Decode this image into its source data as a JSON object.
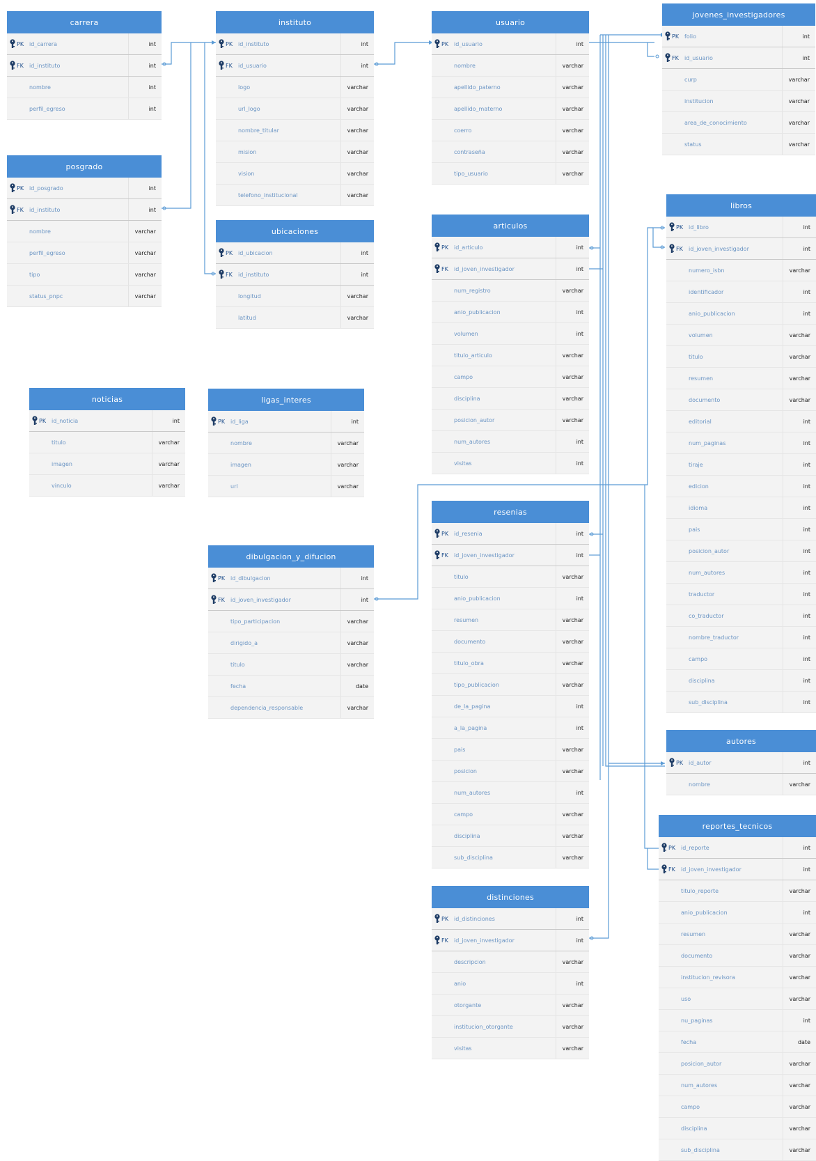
{
  "colors": {
    "header": "#4a8ed6",
    "body": "#f3f3f3",
    "connector": "#5b9bd5",
    "field_name": "#6b95c4",
    "key_icon": "#1f3d66"
  },
  "icons": {
    "key": "key-icon"
  },
  "tables": [
    {
      "id": "carrera",
      "title": "carrera",
      "rows": [
        {
          "key": "PK",
          "name": "id_carrera",
          "type": "int"
        },
        {
          "key": "FK",
          "name": "id_instituto",
          "type": "int"
        },
        {
          "key": "",
          "name": "nombre",
          "type": "int"
        },
        {
          "key": "",
          "name": "perfil_egreso",
          "type": "int"
        }
      ]
    },
    {
      "id": "posgrado",
      "title": "posgrado",
      "rows": [
        {
          "key": "PK",
          "name": "id_posgrado",
          "type": "int"
        },
        {
          "key": "FK",
          "name": "id_instituto",
          "type": "int"
        },
        {
          "key": "",
          "name": "nombre",
          "type": "varchar"
        },
        {
          "key": "",
          "name": "perfil_egreso",
          "type": "varchar"
        },
        {
          "key": "",
          "name": "tipo",
          "type": "varchar"
        },
        {
          "key": "",
          "name": "status_pnpc",
          "type": "varchar"
        }
      ]
    },
    {
      "id": "noticias",
      "title": "noticias",
      "rows": [
        {
          "key": "PK",
          "name": "id_noticia",
          "type": "int"
        },
        {
          "key": "",
          "name": "titulo",
          "type": "varchar"
        },
        {
          "key": "",
          "name": "imagen",
          "type": "varchar"
        },
        {
          "key": "",
          "name": "vinculo",
          "type": "varchar"
        }
      ]
    },
    {
      "id": "instituto",
      "title": "instituto",
      "rows": [
        {
          "key": "PK",
          "name": "id_instituto",
          "type": "int"
        },
        {
          "key": "FK",
          "name": "id_usuario",
          "type": "int"
        },
        {
          "key": "",
          "name": "logo",
          "type": "varchar"
        },
        {
          "key": "",
          "name": "url_logo",
          "type": "varchar"
        },
        {
          "key": "",
          "name": "nombre_titular",
          "type": "varchar"
        },
        {
          "key": "",
          "name": "mision",
          "type": "varchar"
        },
        {
          "key": "",
          "name": "vision",
          "type": "varchar"
        },
        {
          "key": "",
          "name": "telefono_institucional",
          "type": "varchar"
        }
      ]
    },
    {
      "id": "ubicaciones",
      "title": "ubicaciones",
      "rows": [
        {
          "key": "PK",
          "name": "id_ubicacion",
          "type": "int"
        },
        {
          "key": "FK",
          "name": "id_instituto",
          "type": "int"
        },
        {
          "key": "",
          "name": "longitud",
          "type": "varchar"
        },
        {
          "key": "",
          "name": "latitud",
          "type": "varchar"
        }
      ]
    },
    {
      "id": "ligas_interes",
      "title": "ligas_interes",
      "rows": [
        {
          "key": "PK",
          "name": "id_liga",
          "type": "int"
        },
        {
          "key": "",
          "name": "nombre",
          "type": "varchar"
        },
        {
          "key": "",
          "name": "imagen",
          "type": "varchar"
        },
        {
          "key": "",
          "name": "url",
          "type": "varchar"
        }
      ]
    },
    {
      "id": "dibulgacion",
      "title": "dibulgacion_y_difucion",
      "rows": [
        {
          "key": "PK",
          "name": "id_dibulgacion",
          "type": "int"
        },
        {
          "key": "FK",
          "name": "id_joven_investigador",
          "type": "int"
        },
        {
          "key": "",
          "name": "tipo_participacion",
          "type": "varchar"
        },
        {
          "key": "",
          "name": "dirigido_a",
          "type": "varchar"
        },
        {
          "key": "",
          "name": "titulo",
          "type": "varchar"
        },
        {
          "key": "",
          "name": "fecha",
          "type": "date"
        },
        {
          "key": "",
          "name": "dependencia_responsable",
          "type": "varchar"
        }
      ]
    },
    {
      "id": "usuario",
      "title": "usuario",
      "rows": [
        {
          "key": "PK",
          "name": "id_usuario",
          "type": "int"
        },
        {
          "key": "",
          "name": "nombre",
          "type": "varchar"
        },
        {
          "key": "",
          "name": "apellido_paterno",
          "type": "varchar"
        },
        {
          "key": "",
          "name": "apellido_materno",
          "type": "varchar"
        },
        {
          "key": "",
          "name": "coerro",
          "type": "varchar"
        },
        {
          "key": "",
          "name": "contraseña",
          "type": "varchar"
        },
        {
          "key": "",
          "name": "tipo_usuario",
          "type": "varchar"
        }
      ]
    },
    {
      "id": "articulos",
      "title": "articulos",
      "rows": [
        {
          "key": "PK",
          "name": "id_articulo",
          "type": "int"
        },
        {
          "key": "FK",
          "name": "id_joven_investigador",
          "type": "int"
        },
        {
          "key": "",
          "name": "num_registro",
          "type": "varchar"
        },
        {
          "key": "",
          "name": "anio_publicacion",
          "type": "int"
        },
        {
          "key": "",
          "name": "volumen",
          "type": "int"
        },
        {
          "key": "",
          "name": "titulo_articulo",
          "type": "varchar"
        },
        {
          "key": "",
          "name": "campo",
          "type": "varchar"
        },
        {
          "key": "",
          "name": "disciplina",
          "type": "varchar"
        },
        {
          "key": "",
          "name": "posicion_autor",
          "type": "varchar"
        },
        {
          "key": "",
          "name": "num_autores",
          "type": "int"
        },
        {
          "key": "",
          "name": "visitas",
          "type": "int"
        }
      ]
    },
    {
      "id": "resenias",
      "title": "resenias",
      "rows": [
        {
          "key": "PK",
          "name": "id_resenia",
          "type": "int"
        },
        {
          "key": "FK",
          "name": "id_joven_investigador",
          "type": "int"
        },
        {
          "key": "",
          "name": "titulo",
          "type": "varchar"
        },
        {
          "key": "",
          "name": "anio_publicacion",
          "type": "int"
        },
        {
          "key": "",
          "name": "resumen",
          "type": "varchar"
        },
        {
          "key": "",
          "name": "documento",
          "type": "varchar"
        },
        {
          "key": "",
          "name": "titulo_obra",
          "type": "varchar"
        },
        {
          "key": "",
          "name": "tipo_publicacion",
          "type": "varchar"
        },
        {
          "key": "",
          "name": "de_la_pagina",
          "type": "int"
        },
        {
          "key": "",
          "name": "a_la_pagina",
          "type": "int"
        },
        {
          "key": "",
          "name": "pais",
          "type": "varchar"
        },
        {
          "key": "",
          "name": "posicion",
          "type": "varchar"
        },
        {
          "key": "",
          "name": "num_autores",
          "type": "int"
        },
        {
          "key": "",
          "name": "campo",
          "type": "varchar"
        },
        {
          "key": "",
          "name": "disciplina",
          "type": "varchar"
        },
        {
          "key": "",
          "name": "sub_disciplina",
          "type": "varchar"
        }
      ]
    },
    {
      "id": "distinciones",
      "title": "distinciones",
      "rows": [
        {
          "key": "PK",
          "name": "id_distinciones",
          "type": "int"
        },
        {
          "key": "FK",
          "name": "id_joven_investigador",
          "type": "int"
        },
        {
          "key": "",
          "name": "descripcion",
          "type": "varchar"
        },
        {
          "key": "",
          "name": "anio",
          "type": "int"
        },
        {
          "key": "",
          "name": "otorgante",
          "type": "varchar"
        },
        {
          "key": "",
          "name": "institucion_otorgante",
          "type": "varchar"
        },
        {
          "key": "",
          "name": "visitas",
          "type": "varchar"
        }
      ]
    },
    {
      "id": "jovenes",
      "title": "jovenes_investigadores",
      "rows": [
        {
          "key": "PK",
          "name": "folio",
          "type": "int"
        },
        {
          "key": "FK",
          "name": "id_usuario",
          "type": "int"
        },
        {
          "key": "",
          "name": "curp",
          "type": "varchar"
        },
        {
          "key": "",
          "name": "institucion",
          "type": "varchar"
        },
        {
          "key": "",
          "name": "area_de_conocimiento",
          "type": "varchar"
        },
        {
          "key": "",
          "name": "status",
          "type": "varchar"
        }
      ]
    },
    {
      "id": "libros",
      "title": "libros",
      "rows": [
        {
          "key": "PK",
          "name": "id_libro",
          "type": "int"
        },
        {
          "key": "FK",
          "name": "id_joven_investigador",
          "type": "int"
        },
        {
          "key": "",
          "name": "numero_isbn",
          "type": "varchar"
        },
        {
          "key": "",
          "name": "identificador",
          "type": "int"
        },
        {
          "key": "",
          "name": "anio_publicacion",
          "type": "int"
        },
        {
          "key": "",
          "name": "volumen",
          "type": "varchar"
        },
        {
          "key": "",
          "name": "titulo",
          "type": "varchar"
        },
        {
          "key": "",
          "name": "resumen",
          "type": "varchar"
        },
        {
          "key": "",
          "name": "documento",
          "type": "varchar"
        },
        {
          "key": "",
          "name": "editorial",
          "type": "int"
        },
        {
          "key": "",
          "name": "num_paginas",
          "type": "int"
        },
        {
          "key": "",
          "name": "tiraje",
          "type": "int"
        },
        {
          "key": "",
          "name": "edicion",
          "type": "int"
        },
        {
          "key": "",
          "name": "idioma",
          "type": "int"
        },
        {
          "key": "",
          "name": "pais",
          "type": "int"
        },
        {
          "key": "",
          "name": "posicion_autor",
          "type": "int"
        },
        {
          "key": "",
          "name": "num_autores",
          "type": "int"
        },
        {
          "key": "",
          "name": "traductor",
          "type": "int"
        },
        {
          "key": "",
          "name": "co_traductor",
          "type": "int"
        },
        {
          "key": "",
          "name": "nombre_traductor",
          "type": "int"
        },
        {
          "key": "",
          "name": "campo",
          "type": "int"
        },
        {
          "key": "",
          "name": "disciplina",
          "type": "int"
        },
        {
          "key": "",
          "name": "sub_disciplina",
          "type": "int"
        }
      ]
    },
    {
      "id": "autores",
      "title": "autores",
      "rows": [
        {
          "key": "PK",
          "name": "id_autor",
          "type": "int"
        },
        {
          "key": "",
          "name": "nombre",
          "type": "varchar"
        }
      ]
    },
    {
      "id": "reportes",
      "title": "reportes_tecnicos",
      "rows": [
        {
          "key": "PK",
          "name": "id_reporte",
          "type": "int"
        },
        {
          "key": "FK",
          "name": "id_joven_investigador",
          "type": "int"
        },
        {
          "key": "",
          "name": "titulo_reporte",
          "type": "varchar"
        },
        {
          "key": "",
          "name": "anio_publicacion",
          "type": "int"
        },
        {
          "key": "",
          "name": "resumen",
          "type": "varchar"
        },
        {
          "key": "",
          "name": "documento",
          "type": "varchar"
        },
        {
          "key": "",
          "name": "institucion_revisora",
          "type": "varchar"
        },
        {
          "key": "",
          "name": "uso",
          "type": "varchar"
        },
        {
          "key": "",
          "name": "nu_paginas",
          "type": "int"
        },
        {
          "key": "",
          "name": "fecha",
          "type": "date"
        },
        {
          "key": "",
          "name": "posicion_autor",
          "type": "varchar"
        },
        {
          "key": "",
          "name": "num_autores",
          "type": "varchar"
        },
        {
          "key": "",
          "name": "campo",
          "type": "varchar"
        },
        {
          "key": "",
          "name": "disciplina",
          "type": "varchar"
        },
        {
          "key": "",
          "name": "sub_disciplina",
          "type": "varchar"
        }
      ]
    }
  ]
}
